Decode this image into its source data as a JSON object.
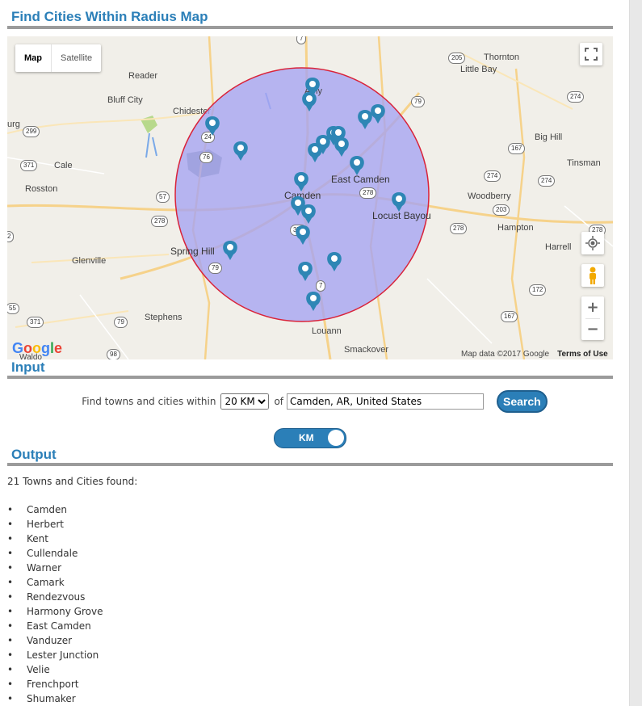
{
  "page": {
    "map_title": "Find Cities Within Radius Map",
    "input_title": "Input",
    "output_title": "Output"
  },
  "map": {
    "type_map": "Map",
    "type_satellite": "Satellite",
    "google": "Google",
    "attribution": "Map data ©2017 Google",
    "terms": "Terms of Use",
    "circle_fill": "#a5a3f2",
    "circle_stroke": "#d9233a",
    "pin_color": "#2e86b5",
    "places": [
      {
        "name": "Amy"
      },
      {
        "name": "Camden"
      },
      {
        "name": "East Camden"
      },
      {
        "name": "Locust Bayou"
      },
      {
        "name": "Spring Hill"
      },
      {
        "name": "Louann"
      },
      {
        "name": "Smackover"
      },
      {
        "name": "Chidester"
      },
      {
        "name": "Bluff City"
      },
      {
        "name": "Reader"
      },
      {
        "name": "Cale"
      },
      {
        "name": "Rosston"
      },
      {
        "name": "Glenville"
      },
      {
        "name": "Stephens"
      },
      {
        "name": "Thornton"
      },
      {
        "name": "Little Bay"
      },
      {
        "name": "Big Hill"
      },
      {
        "name": "Tinsman"
      },
      {
        "name": "Woodberry"
      },
      {
        "name": "Hampton"
      },
      {
        "name": "Harrell"
      },
      {
        "name": "urg"
      },
      {
        "name": "Waldo"
      }
    ],
    "shields": [
      "7",
      "205",
      "79",
      "274",
      "299",
      "24",
      "371",
      "76",
      "167",
      "274",
      "274",
      "57",
      "278",
      "203",
      "278",
      "376",
      "278",
      "79",
      "7",
      "172",
      "167",
      "79",
      "98",
      "371",
      "55",
      "2",
      "278"
    ]
  },
  "input": {
    "label": "Find towns and cities within",
    "radius_selected": "20 KM",
    "of_label": "of",
    "location_value": "Camden, AR, United States",
    "search_label": "Search",
    "unit_toggle": "KM"
  },
  "output": {
    "count_text": "21 Towns and Cities found:",
    "towns": [
      "Camden",
      "Herbert",
      "Kent",
      "Cullendale",
      "Warner",
      "Camark",
      "Rendezvous",
      "Harmony Grove",
      "East Camden",
      "Vanduzer",
      "Lester Junction",
      "Velie",
      "Frenchport",
      "Shumaker"
    ]
  }
}
